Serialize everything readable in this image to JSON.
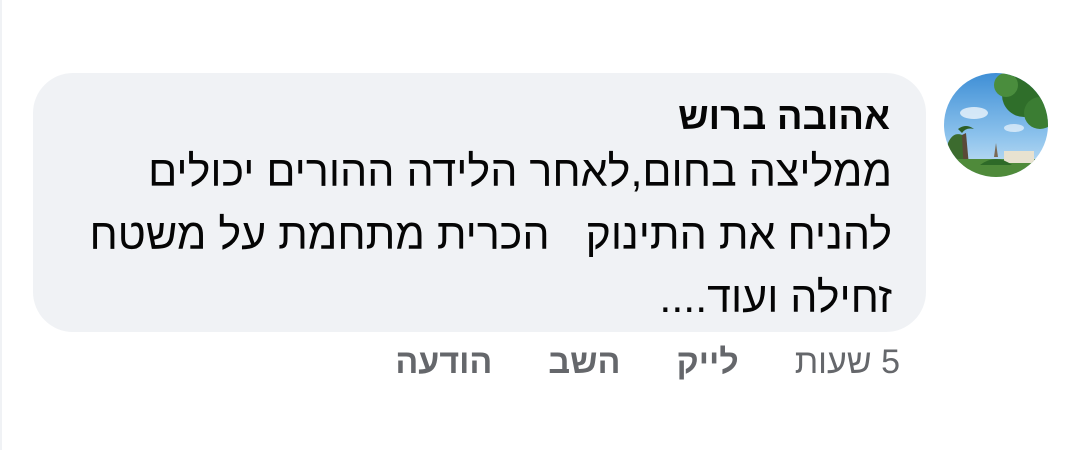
{
  "comment": {
    "author": "אהובה ברוש",
    "text": "ממליצה בחום,לאחר הלידה ההורים יכולים להניח את התינוק   הכרית מתחמת על משטח זחילה ועוד....",
    "avatar_icon": "profile-photo"
  },
  "actions": {
    "timestamp": "5 שעות",
    "like": "לייק",
    "reply": "השב",
    "message": "הודעה"
  },
  "colors": {
    "bubble": "#f0f2f5",
    "text": "#050505",
    "secondary": "#65676b"
  }
}
